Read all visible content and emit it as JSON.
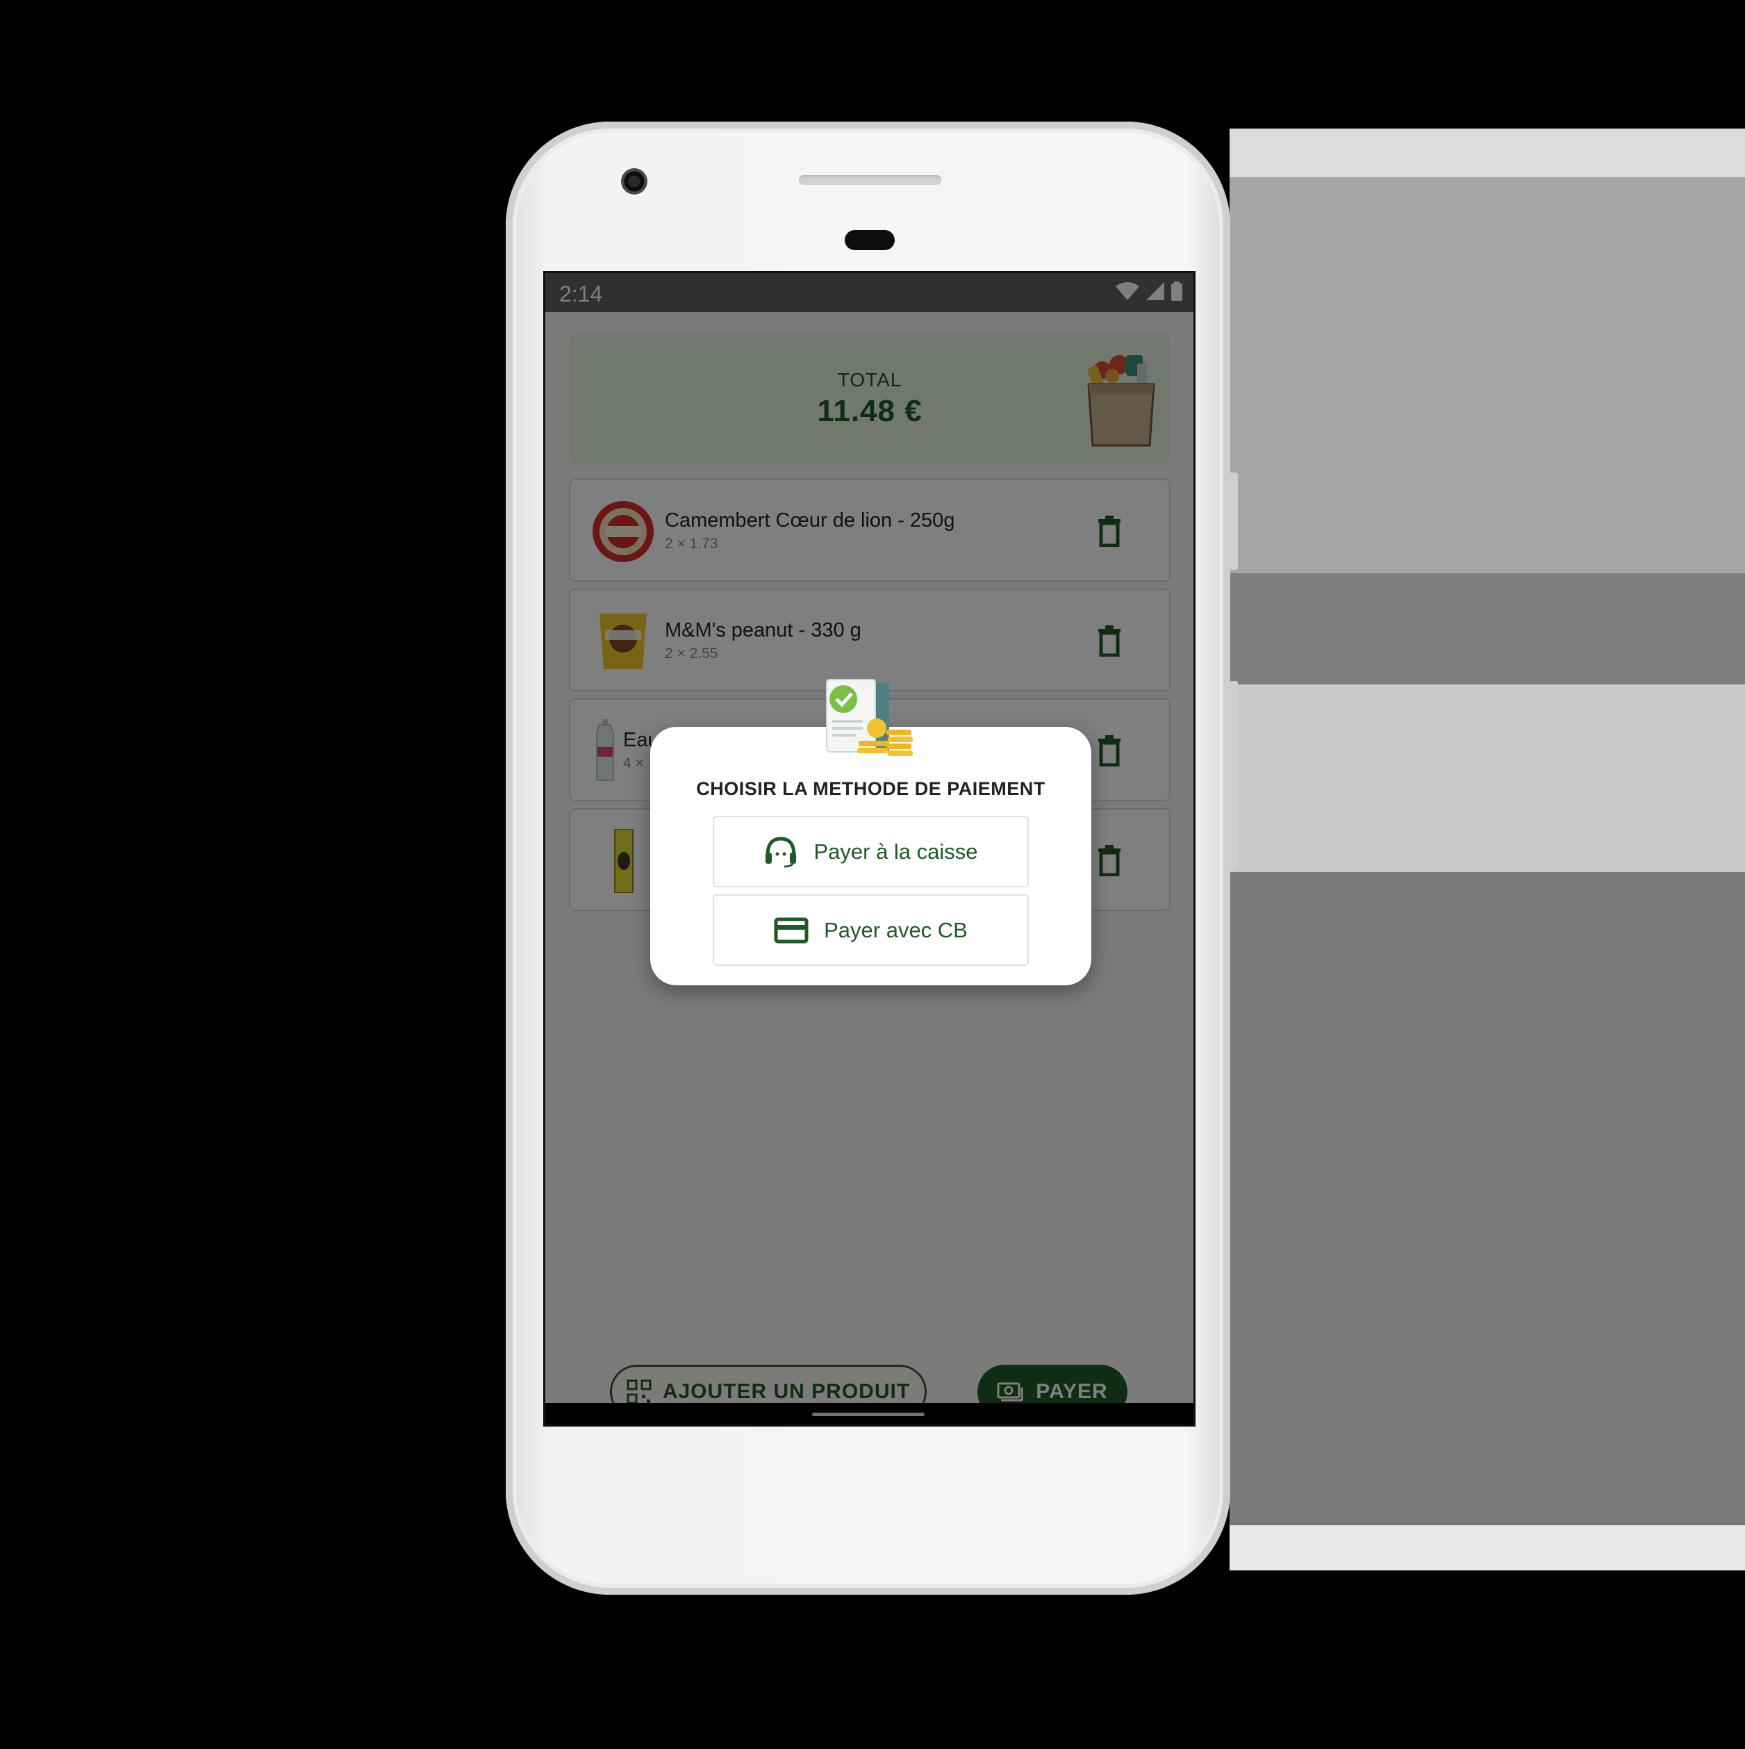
{
  "status_bar": {
    "time": "2:14"
  },
  "cart": {
    "total_label": "TOTAL",
    "total_amount": "11.48 €",
    "items": [
      {
        "name": "Camembert Cœur de lion - 250g",
        "qty": "2 × 1.73"
      },
      {
        "name": "M&M's peanut - 330 g",
        "qty": "2 × 2.55"
      },
      {
        "name": "Eau",
        "qty": "4 ×"
      },
      {
        "name": "",
        "qty": ""
      }
    ]
  },
  "actions": {
    "add_product": "AJOUTER UN PRODUIT",
    "pay": "PAYER"
  },
  "dialog": {
    "title": "CHOISIR LA METHODE DE PAIEMENT",
    "options": [
      {
        "label": "Payer à la caisse",
        "icon": "headset-icon"
      },
      {
        "label": "Payer avec CB",
        "icon": "credit-card-icon"
      }
    ]
  },
  "colors": {
    "primary": "#1e5a26",
    "card_bg": "#e5eee1",
    "scrim": "rgba(0,0,0,0.5)"
  }
}
